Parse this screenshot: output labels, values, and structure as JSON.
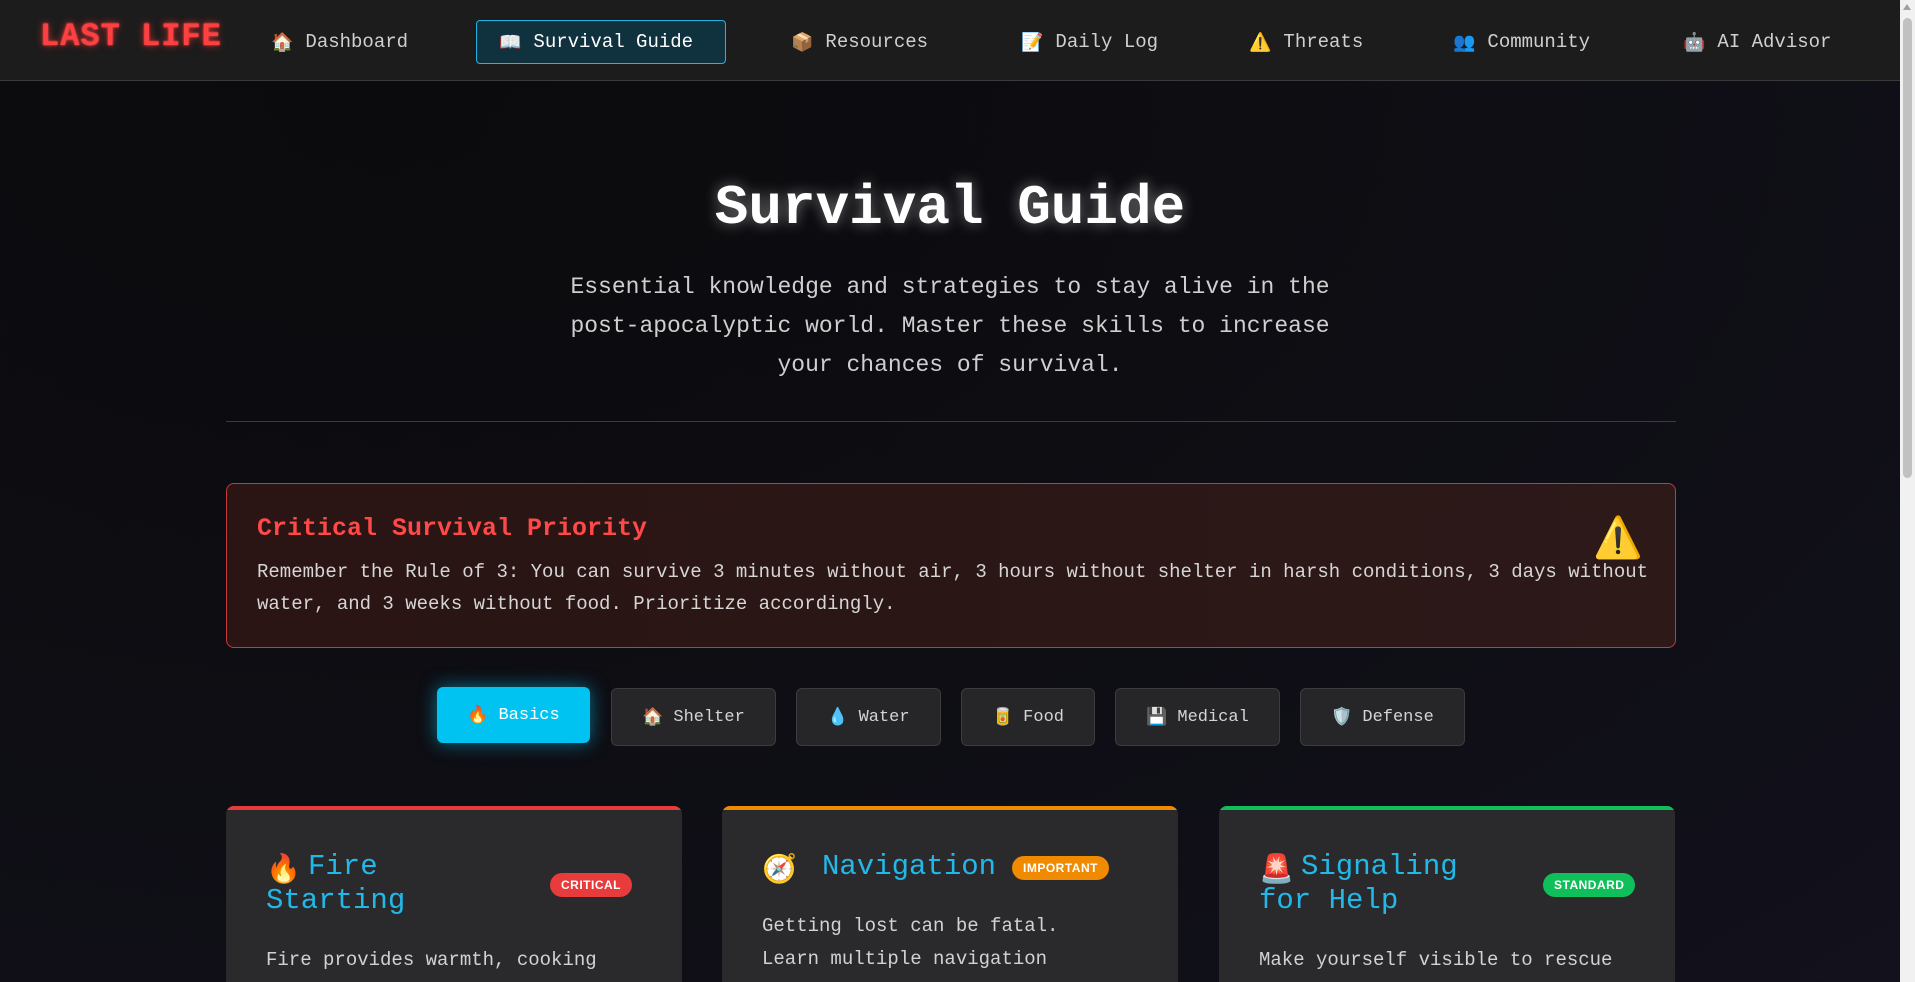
{
  "nav": {
    "logo": "LAST LIFE",
    "items": [
      {
        "icon": "🏠",
        "label": "Dashboard"
      },
      {
        "icon": "📖",
        "label": "Survival Guide"
      },
      {
        "icon": "📦",
        "label": "Resources"
      },
      {
        "icon": "📝",
        "label": "Daily Log"
      },
      {
        "icon": "⚠️",
        "label": "Threats"
      },
      {
        "icon": "👥",
        "label": "Community"
      },
      {
        "icon": "🤖",
        "label": "AI Advisor"
      }
    ],
    "active_index": 1
  },
  "hero": {
    "title": "Survival Guide",
    "subtitle": "Essential knowledge and strategies to stay alive in the post-apocalyptic world. Master these skills to increase your chances of survival."
  },
  "alert": {
    "title": "Critical Survival Priority",
    "text": "Remember the Rule of 3: You can survive 3 minutes without air, 3 hours without shelter in harsh conditions, 3 days without water, and 3 weeks without food. Prioritize accordingly.",
    "icon": "⚠️"
  },
  "tabs": [
    {
      "icon": "🔥",
      "label": "Basics"
    },
    {
      "icon": "🏠",
      "label": "Shelter"
    },
    {
      "icon": "💧",
      "label": "Water"
    },
    {
      "icon": "🥫",
      "label": "Food"
    },
    {
      "icon": "💾",
      "label": "Medical"
    },
    {
      "icon": "🛡️",
      "label": "Defense"
    }
  ],
  "active_tab": 0,
  "cards": [
    {
      "icon": "🔥",
      "title_line1": "Fire",
      "title_line2": "Starting",
      "badge": "CRITICAL",
      "badge_color": "#e83b3b",
      "accent_color": "#e83b3b",
      "desc_line1": "Fire provides warmth, cooking"
    },
    {
      "icon": "🧭",
      "title_line1": "Navigation",
      "title_line2": "",
      "badge": "IMPORTANT",
      "badge_color": "#f08a00",
      "accent_color": "#f08a00",
      "desc_line1": "Getting lost can be fatal.",
      "desc_line2": "Learn multiple navigation"
    },
    {
      "icon": "🚨",
      "title_line1": "Signaling",
      "title_line2": "for Help",
      "badge": "STANDARD",
      "badge_color": "#0fbf5a",
      "accent_color": "#0fbf5a",
      "desc_line1": "Make yourself visible to rescue"
    }
  ]
}
